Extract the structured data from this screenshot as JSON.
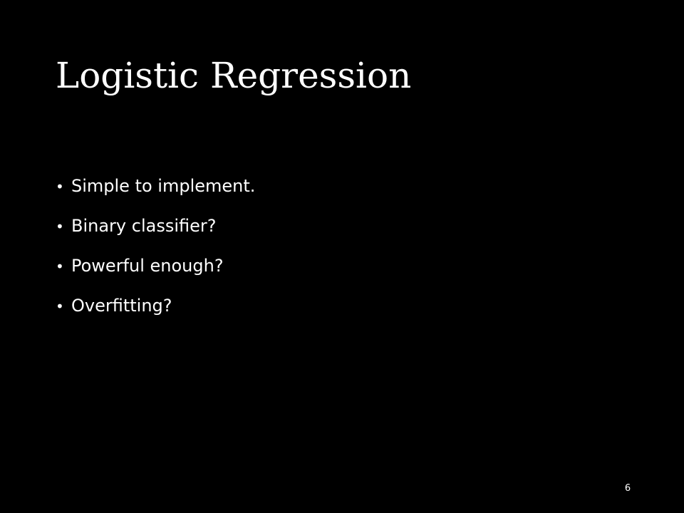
{
  "slide": {
    "title": "Logistic Regression",
    "bullet_glyph": "•",
    "bullets": [
      "Simple to implement.",
      "Binary classifier?",
      "Powerful enough?",
      "Overfitting?"
    ],
    "page_number": "6",
    "background_color": "#000000",
    "text_color": "#ffffff"
  }
}
